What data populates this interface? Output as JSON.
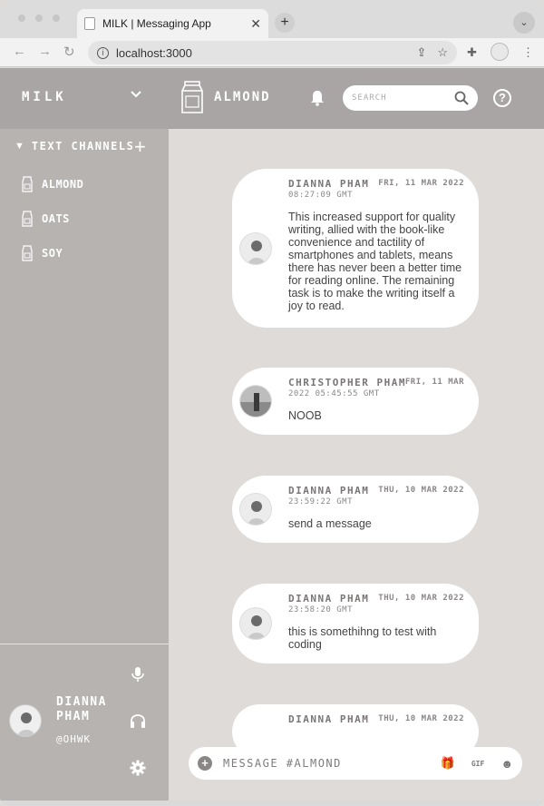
{
  "browser": {
    "tab_title": "MILK | Messaging App",
    "url": "localhost:3000"
  },
  "app": {
    "workspace": "MILK",
    "channel_header": "ALMOND",
    "search_placeholder": "SEARCH",
    "help_label": "?"
  },
  "sidebar": {
    "section_title": "TEXT CHANNELS",
    "channels": [
      {
        "name": "ALMOND"
      },
      {
        "name": "OATS"
      },
      {
        "name": "SOY"
      }
    ]
  },
  "user": {
    "name": "DIANNA PHAM",
    "handle": "@OHWK"
  },
  "messages": [
    {
      "author": "DIANNA PHAM",
      "date": "FRI, 11 MAR 2022",
      "time": "08:27:09 GMT",
      "text": "This increased support for quality writing, allied with the book-like convenience and tactility of smartphones and tablets, means there has never been a better time for reading online. The remaining task is to make the writing itself a joy to read."
    },
    {
      "author": "CHRISTOPHER PHAM",
      "date": "FRI, 11 MAR",
      "time": "2022 05:45:55 GMT",
      "text": "NOOB"
    },
    {
      "author": "DIANNA PHAM",
      "date": "THU, 10 MAR 2022",
      "time": "23:59:22 GMT",
      "text": "send a message"
    },
    {
      "author": "DIANNA PHAM",
      "date": "THU, 10 MAR 2022",
      "time": "23:58:20 GMT",
      "text": "this is somethihng to test with coding"
    },
    {
      "author": "DIANNA PHAM",
      "date": "THU, 10 MAR 2022",
      "time": "",
      "text": ""
    }
  ],
  "composer": {
    "placeholder": "MESSAGE #ALMOND",
    "gif_label": "GIF"
  },
  "colors": {
    "header_bg": "#a9a5a4",
    "sidebar_bg": "#b6b3b1",
    "main_bg": "#dedbd9",
    "bubble_bg": "#ffffff"
  },
  "icons": {
    "channel": "milk-carton-icon",
    "notifications": "bell-icon",
    "search": "search-icon",
    "mic": "microphone-icon",
    "headphones": "headphones-icon",
    "settings": "gear-icon",
    "gift": "gift-icon",
    "emoji": "emoji-icon"
  }
}
